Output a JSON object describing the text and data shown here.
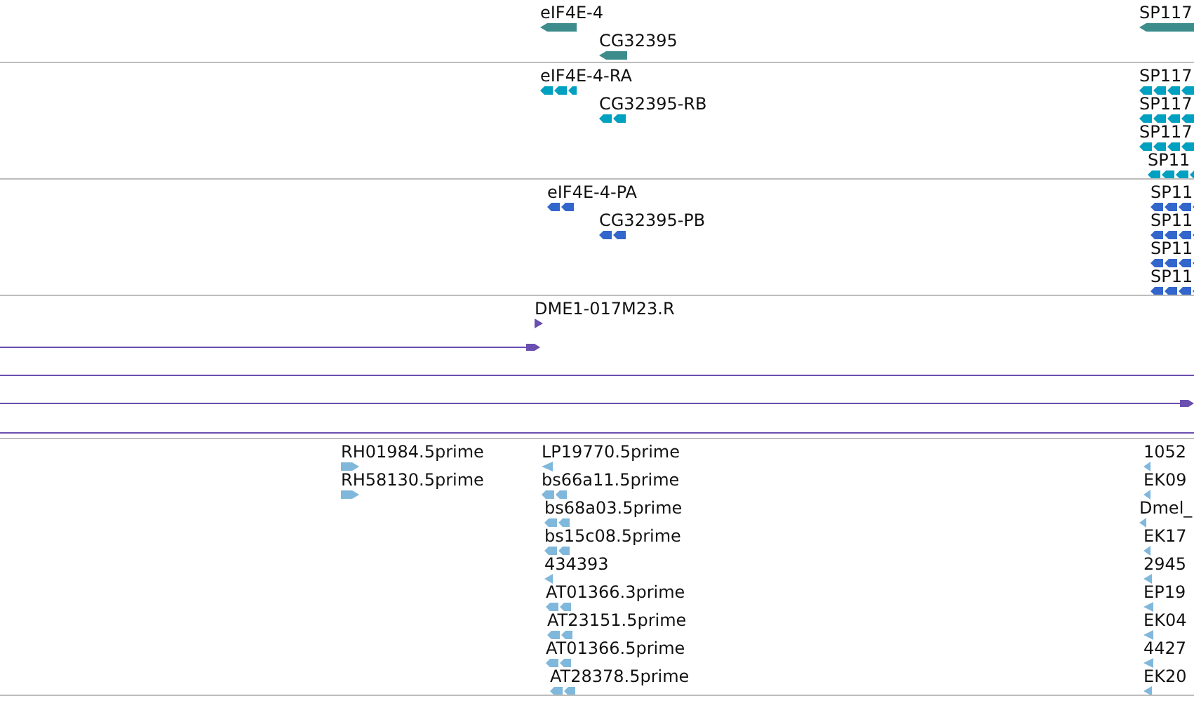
{
  "tracks": [
    {
      "color": "#3d8c8c",
      "features": [
        {
          "label": "eIF4E-4",
          "kind": "block",
          "reverse": true
        },
        {
          "label": "CG32395",
          "kind": "block",
          "reverse": true
        },
        {
          "label": "SP117",
          "kind": "block",
          "reverse": true
        }
      ]
    },
    {
      "color": "#00a0c0",
      "features": [
        {
          "label": "eIF4E-4-RA",
          "kind": "split",
          "reverse": true
        },
        {
          "label": "CG32395-RB",
          "kind": "split",
          "reverse": true
        },
        {
          "label": "SP117",
          "kind": "split",
          "reverse": true
        },
        {
          "label": "SP117",
          "kind": "split",
          "reverse": true
        },
        {
          "label": "SP117",
          "kind": "split",
          "reverse": true
        },
        {
          "label": "SP11",
          "kind": "split",
          "reverse": true
        }
      ]
    },
    {
      "color": "#3366cc",
      "features": [
        {
          "label": "eIF4E-4-PA",
          "kind": "split",
          "reverse": true
        },
        {
          "label": "CG32395-PB",
          "kind": "split",
          "reverse": true
        },
        {
          "label": "SP11",
          "kind": "split",
          "reverse": true
        },
        {
          "label": "SP11",
          "kind": "split",
          "reverse": true
        },
        {
          "label": "SP11",
          "kind": "split",
          "reverse": true
        },
        {
          "label": "SP11",
          "kind": "split",
          "reverse": true
        }
      ]
    },
    {
      "color": "#6a4fb0",
      "features": [
        {
          "label": "DME1-017M23.R",
          "kind": "tick",
          "reverse": false
        }
      ],
      "alignments": [
        {
          "arrow": true
        },
        {
          "arrow": false
        },
        {
          "arrow": true
        },
        {
          "arrow": false
        }
      ]
    },
    {
      "color": "#80b8dc",
      "features": [
        {
          "label": "RH01984.5prime",
          "kind": "block",
          "reverse": false
        },
        {
          "label": "RH58130.5prime",
          "kind": "block",
          "reverse": false
        },
        {
          "label": "LP19770.5prime",
          "kind": "tick",
          "reverse": true
        },
        {
          "label": "bs66a11.5prime",
          "kind": "split",
          "reverse": true
        },
        {
          "label": "bs68a03.5prime",
          "kind": "split",
          "reverse": true
        },
        {
          "label": "bs15c08.5prime",
          "kind": "split",
          "reverse": true
        },
        {
          "label": "434393",
          "kind": "tick",
          "reverse": true
        },
        {
          "label": "AT01366.3prime",
          "kind": "split",
          "reverse": true
        },
        {
          "label": "AT23151.5prime",
          "kind": "split",
          "reverse": true
        },
        {
          "label": "AT01366.5prime",
          "kind": "split",
          "reverse": true
        },
        {
          "label": "AT28378.5prime",
          "kind": "split",
          "reverse": true
        },
        {
          "label": "1052",
          "kind": "tick",
          "reverse": true
        },
        {
          "label": "EK09",
          "kind": "tick",
          "reverse": true
        },
        {
          "label": "Dmel_",
          "kind": "tick",
          "reverse": true
        },
        {
          "label": "EK17",
          "kind": "tick",
          "reverse": true
        },
        {
          "label": "2945",
          "kind": "tick",
          "reverse": true
        },
        {
          "label": "EP19",
          "kind": "tick",
          "reverse": true
        },
        {
          "label": "EK04",
          "kind": "tick",
          "reverse": true
        },
        {
          "label": "4427",
          "kind": "tick",
          "reverse": true
        },
        {
          "label": "EK20",
          "kind": "tick",
          "reverse": true
        }
      ]
    }
  ]
}
